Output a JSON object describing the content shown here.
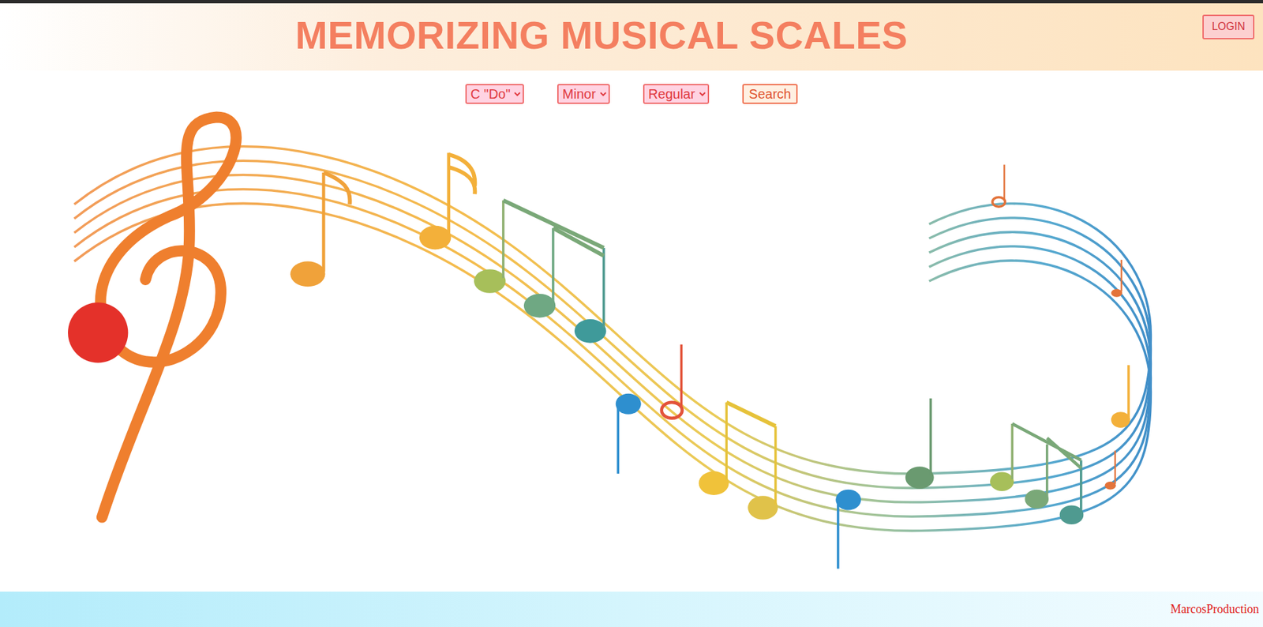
{
  "header": {
    "title": "MEMORIZING MUSICAL SCALES",
    "login": "LOGIN"
  },
  "controls": {
    "selects": [
      {
        "name": "note",
        "value": "C \"Do\""
      },
      {
        "name": "mode",
        "value": "Minor"
      },
      {
        "name": "variant",
        "value": "Regular"
      }
    ],
    "search": "Search"
  },
  "footer": {
    "credit": "MarcosProduction"
  }
}
